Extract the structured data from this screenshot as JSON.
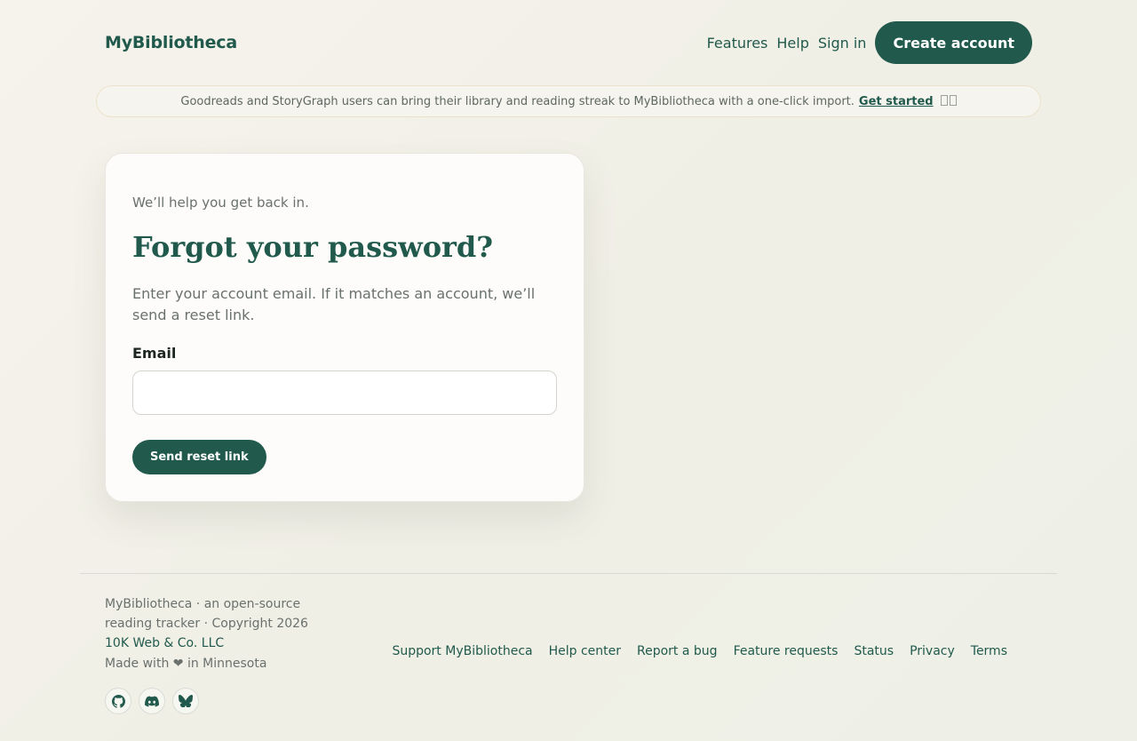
{
  "header": {
    "brand": "MyBibliotheca",
    "nav": [
      {
        "label": "Features"
      },
      {
        "label": "Help"
      },
      {
        "label": "Sign in"
      }
    ],
    "cta": "Create account"
  },
  "banner": {
    "text": "Goodreads and StoryGraph users can bring their library and reading streak to MyBibliotheca with a one-click import.",
    "link": "Get started",
    "close_icon": "close-icon"
  },
  "card": {
    "kicker": "We’ll help you get back in.",
    "title": "Forgot your password?",
    "description": "Enter your account email. If it matches an account, we’ll send a reset link.",
    "email_label": "Email",
    "email_value": "",
    "email_placeholder": "",
    "submit": "Send reset link"
  },
  "footer": {
    "tagline": "MyBibliotheca · an open-source reading tracker · Copyright 2026",
    "company": "10K Web & Co. LLC",
    "made_with": "Made with ❤ in Minnesota",
    "socials": [
      "github-icon",
      "discord-icon",
      "bluesky-icon"
    ],
    "links": [
      {
        "label": "Support MyBibliotheca"
      },
      {
        "label": "Help center"
      },
      {
        "label": "Report a bug"
      },
      {
        "label": "Feature requests"
      },
      {
        "label": "Status"
      },
      {
        "label": "Privacy"
      },
      {
        "label": "Terms"
      }
    ]
  },
  "colors": {
    "brand_green": "#215a4c",
    "muted_text": "#6a716d",
    "banner_border": "#ebe3c9"
  }
}
